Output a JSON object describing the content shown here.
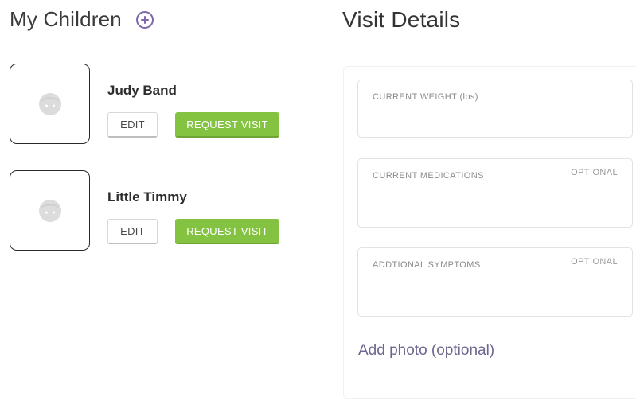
{
  "children": {
    "title": "My Children",
    "add_icon": "plus-circle-icon",
    "list": [
      {
        "name": "Judy Band",
        "edit_label": "EDIT",
        "request_label": "REQUEST VISIT",
        "avatar_icon": "child-face-icon"
      },
      {
        "name": "Little Timmy",
        "edit_label": "EDIT",
        "request_label": "REQUEST VISIT",
        "avatar_icon": "child-face-icon"
      }
    ]
  },
  "visit": {
    "title": "Visit Details",
    "fields": [
      {
        "label": "CURRENT WEIGHT (lbs)",
        "optional": "",
        "value": ""
      },
      {
        "label": "CURRENT MEDICATIONS",
        "optional": "OPTIONAL",
        "value": ""
      },
      {
        "label": "ADDTIONAL SYMPTOMS",
        "optional": "OPTIONAL",
        "value": ""
      }
    ],
    "add_photo_label": "Add photo (optional)"
  },
  "colors": {
    "accent_purple": "#7d67a8",
    "request_green": "#84c341",
    "link_purple": "#6d6790",
    "avatar_gray": "#dcdcdc"
  }
}
